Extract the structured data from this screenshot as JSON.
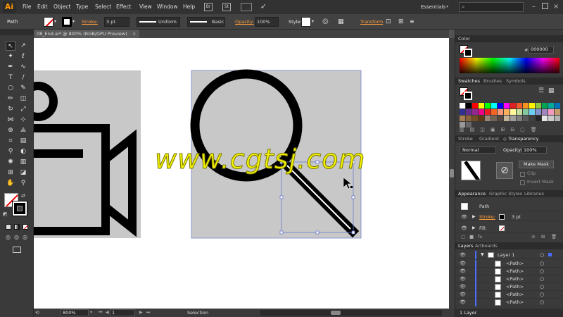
{
  "app": {
    "logo": "Ai",
    "workspace": "Essentials",
    "search_placeholder": ""
  },
  "menu": [
    "File",
    "Edit",
    "Object",
    "Type",
    "Select",
    "Effect",
    "View",
    "Window",
    "Help"
  ],
  "control": {
    "selection_type": "Path",
    "stroke_label": "Stroke:",
    "stroke_weight": "3 pt",
    "profile": "Uniform",
    "brush": "Basic",
    "opacity_label": "Opacity:",
    "opacity": "100%",
    "style_label": "Style:",
    "transform_label": "Transform",
    "br_badge": "Br",
    "st_badge": "St"
  },
  "document": {
    "tab": "08_End.ai* @ 800% (RGB/GPU Preview)",
    "close": "×"
  },
  "watermark": "www.cgtsj.com",
  "status": {
    "zoom": "800%",
    "artboard": "1",
    "tool": "Selection"
  },
  "color_panel": {
    "title": "Color",
    "hex_prefix": "#",
    "hex": "000000"
  },
  "swatches_panel": {
    "tabs": [
      "Swatches",
      "Brushes",
      "Symbols"
    ],
    "colors": [
      "#ffffff",
      "#000000",
      "#ff0000",
      "#ffff00",
      "#00ff00",
      "#00ffff",
      "#0000ff",
      "#ff00ff",
      "#e02020",
      "#f05a28",
      "#f7941d",
      "#fff200",
      "#8dc63f",
      "#00a651",
      "#00a99d",
      "#0072bc",
      "#2e3192",
      "#662d91",
      "#92278f",
      "#ec008c",
      "#ed1c24",
      "#f26522",
      "#f7977a",
      "#fbaf5d",
      "#fff799",
      "#c4df9b",
      "#82ca9c",
      "#6dcff6",
      "#8393ca",
      "#a186be",
      "#f49ac1",
      "#c69c6d",
      "#a67c52",
      "#8c6239",
      "#754c24",
      "#603913",
      "#998675",
      "#736357",
      "#534741",
      "#c2b59b",
      "#9e9e9e",
      "#7f7f7f",
      "#595959",
      "#404040",
      "#262626",
      "#e6e6e6",
      "#cccccc",
      "#b3b3b3",
      "#999999",
      "#666666"
    ]
  },
  "stroke_panel": {
    "tabs": [
      "Stroke",
      "Gradient",
      "Transparency"
    ],
    "mode": "Normal",
    "opacity_label": "Opacity:",
    "opacity": "100%",
    "make_mask": "Make Mask",
    "clip": "Clip",
    "invert_mask": "Invert Mask"
  },
  "appearance_panel": {
    "tabs": [
      "Appearance",
      "Graphic Styles",
      "Libraries"
    ],
    "object": "Path",
    "stroke_label": "Stroke:",
    "stroke_value": "3 pt",
    "fill_label": "Fill:",
    "fx": "fx."
  },
  "layers_panel": {
    "tabs": [
      "Layers",
      "Artboards"
    ],
    "layer": "Layer 1",
    "items": [
      "<Path>",
      "<Path>",
      "<Path>",
      "<Path>",
      "<Path>",
      "<Path>"
    ],
    "count": "1 Layer"
  }
}
